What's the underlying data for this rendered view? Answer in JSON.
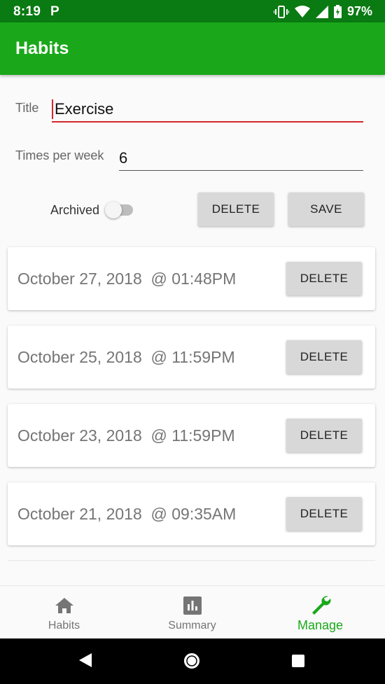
{
  "status_bar": {
    "time": "8:19",
    "app_icon": "P",
    "battery": "97%"
  },
  "app_bar": {
    "title": "Habits"
  },
  "form": {
    "title_label": "Title",
    "title_value": "Exercise",
    "times_label": "Times per week",
    "times_value": "6",
    "archived_label": "Archived",
    "archived_on": false,
    "delete_label": "DELETE",
    "save_label": "SAVE"
  },
  "entries": [
    {
      "date": "October 27, 2018  @ 01:48PM",
      "delete_label": "DELETE"
    },
    {
      "date": "October 25, 2018  @ 11:59PM",
      "delete_label": "DELETE"
    },
    {
      "date": "October 23, 2018  @ 11:59PM",
      "delete_label": "DELETE"
    },
    {
      "date": "October 21, 2018  @ 09:35AM",
      "delete_label": "DELETE"
    }
  ],
  "bottom_nav": {
    "items": [
      {
        "label": "Habits",
        "icon": "home-icon"
      },
      {
        "label": "Summary",
        "icon": "chart-icon"
      },
      {
        "label": "Manage",
        "icon": "wrench-icon",
        "active": true
      }
    ]
  },
  "colors": {
    "primary": "#1aa81a",
    "status_bar": "#0a7a12",
    "accent": "#d6262b"
  }
}
